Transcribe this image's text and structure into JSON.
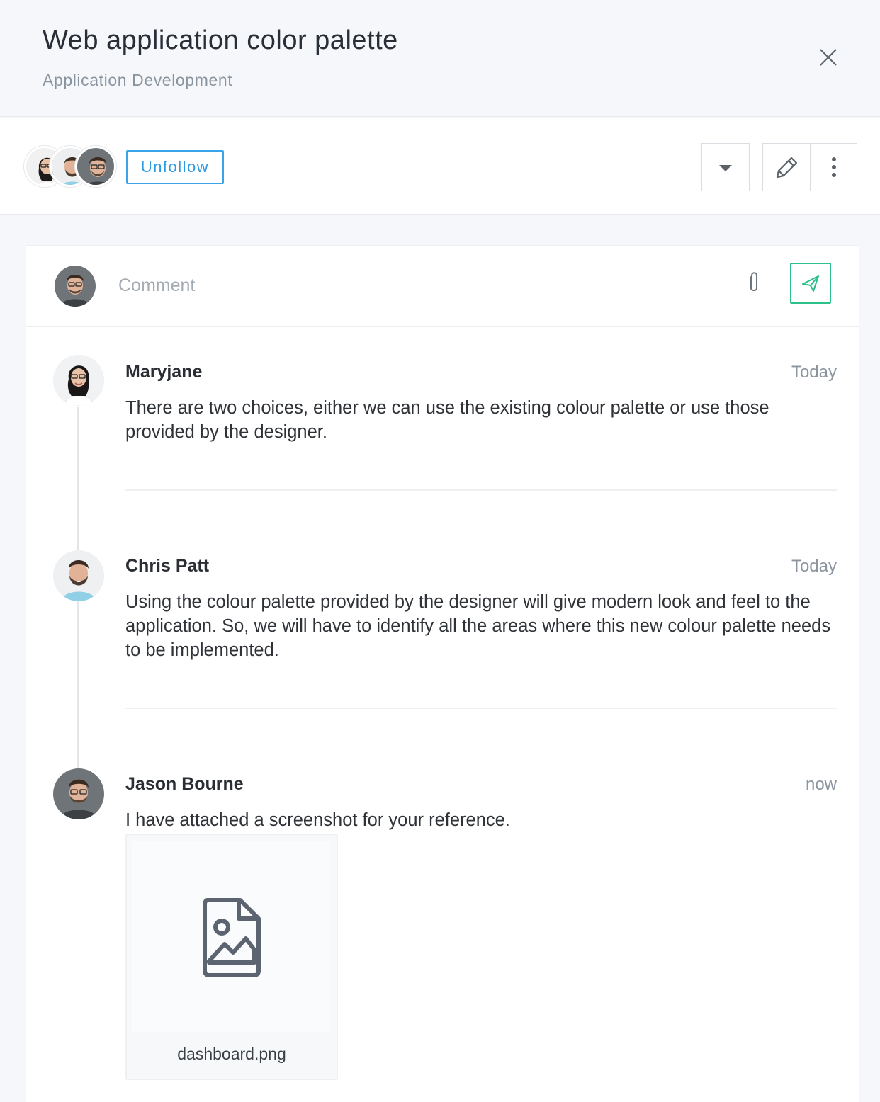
{
  "header": {
    "title": "Web application color palette",
    "subtitle": "Application Development"
  },
  "toolbar": {
    "followers": [
      "Maryjane",
      "Chris Patt",
      "Jason Bourne"
    ],
    "unfollow_label": "Unfollow"
  },
  "composer": {
    "placeholder": "Comment"
  },
  "comments": [
    {
      "author": "Maryjane",
      "time": "Today",
      "text": "There are two choices, either we can use the existing colour palette or use those provided by the designer."
    },
    {
      "author": "Chris Patt",
      "time": "Today",
      "text": "Using the colour palette provided by the designer will give modern look and feel to the application. So, we will have to identify all the areas where this new colour palette needs to be implemented."
    },
    {
      "author": "Jason Bourne",
      "time": "now",
      "text": "I have attached a screenshot for your reference.",
      "attachment": {
        "file_name": "dashboard.png"
      }
    }
  ],
  "colors": {
    "accent_blue": "#3ba4e8",
    "accent_green": "#2cc08a",
    "muted_text": "#8a949e"
  }
}
